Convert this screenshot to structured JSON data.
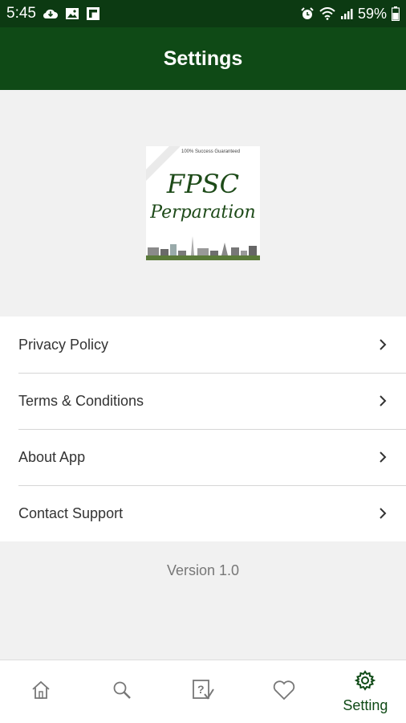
{
  "status_bar": {
    "time": "5:45",
    "battery": "59%",
    "left_icons": [
      "cloud-icon",
      "image-icon",
      "flipboard-icon"
    ],
    "right_icons": [
      "alarm-icon",
      "wifi-icon",
      "signal-icon",
      "battery-icon"
    ]
  },
  "app_bar": {
    "title": "Settings"
  },
  "logo": {
    "tagline": "100% Success Guaranteed",
    "line1": "FPSC",
    "line2": "Perparation"
  },
  "menu": {
    "items": [
      {
        "label": "Privacy Policy",
        "icon": "chevron-right-icon"
      },
      {
        "label": "Terms & Conditions",
        "icon": "chevron-right-icon"
      },
      {
        "label": "About App",
        "icon": "chevron-right-icon"
      },
      {
        "label": "Contact Support",
        "icon": "chevron-right-icon"
      }
    ]
  },
  "version": "Version 1.0",
  "bottom_nav": {
    "items": [
      {
        "icon": "home-icon",
        "label": ""
      },
      {
        "icon": "search-icon",
        "label": ""
      },
      {
        "icon": "quiz-icon",
        "label": ""
      },
      {
        "icon": "heart-icon",
        "label": ""
      },
      {
        "icon": "gear-icon",
        "label": "Setting"
      }
    ],
    "active_color": "#0f4a16"
  },
  "colors": {
    "status_bar": "#0c3a12",
    "app_bar": "#0f4a16",
    "background": "#f1f1f1"
  }
}
